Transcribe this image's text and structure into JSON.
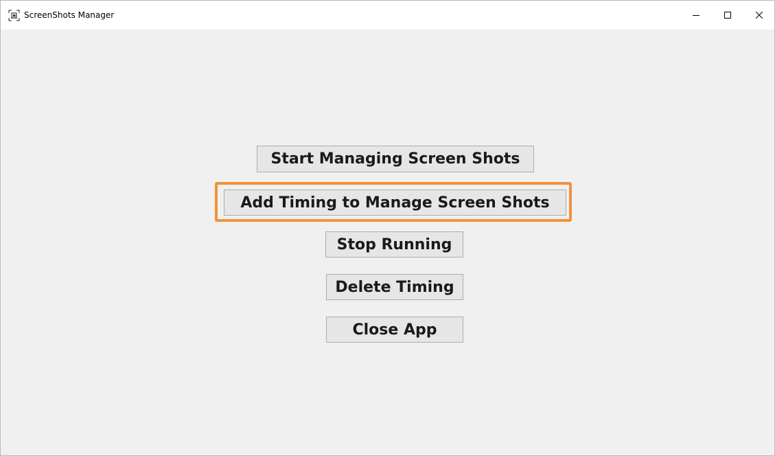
{
  "window": {
    "title": "ScreenShots Manager",
    "icon": "screenshot-app-icon",
    "controls": {
      "minimize_icon": "minimize-icon",
      "maximize_icon": "maximize-icon",
      "close_icon": "close-icon"
    }
  },
  "buttons": {
    "start": "Start Managing Screen Shots",
    "add_timing": "Add Timing to Manage Screen Shots",
    "stop": "Stop Running",
    "delete_timing": "Delete Timing",
    "close_app": "Close App"
  },
  "highlight": {
    "target": "add-timing-button",
    "color": "#f4913a"
  },
  "colors": {
    "background": "#f0f0f0",
    "titlebar": "#ffffff",
    "button_face": "#e6e6e6",
    "button_border": "#adadad"
  }
}
